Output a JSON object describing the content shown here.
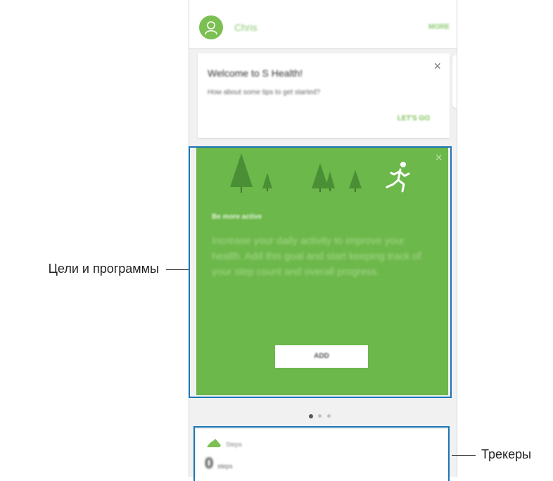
{
  "header": {
    "username": "Chris",
    "more_label": "MORE",
    "avatar_icon": "user-avatar-icon"
  },
  "welcome_card": {
    "title": "Welcome to S Health!",
    "subtitle": "How about some tips to get started?",
    "action_label": "LET'S GO",
    "close_label": "×"
  },
  "goal_card": {
    "title": "Be more active",
    "description": "Increase your daily activity to improve your health. Add this goal and start keeping track of your step count and overall progress.",
    "add_label": "ADD",
    "close_label": "×",
    "background_color": "#6cb84a"
  },
  "pager": {
    "count": 3,
    "active_index": 0
  },
  "tracker_card": {
    "label": "Steps",
    "count": "0",
    "unit": "steps"
  },
  "callouts": {
    "goals_label": "Цели и программы",
    "trackers_label": "Трекеры"
  },
  "colors": {
    "accent_green": "#7cbf52",
    "highlight_blue": "#1b76b7"
  }
}
